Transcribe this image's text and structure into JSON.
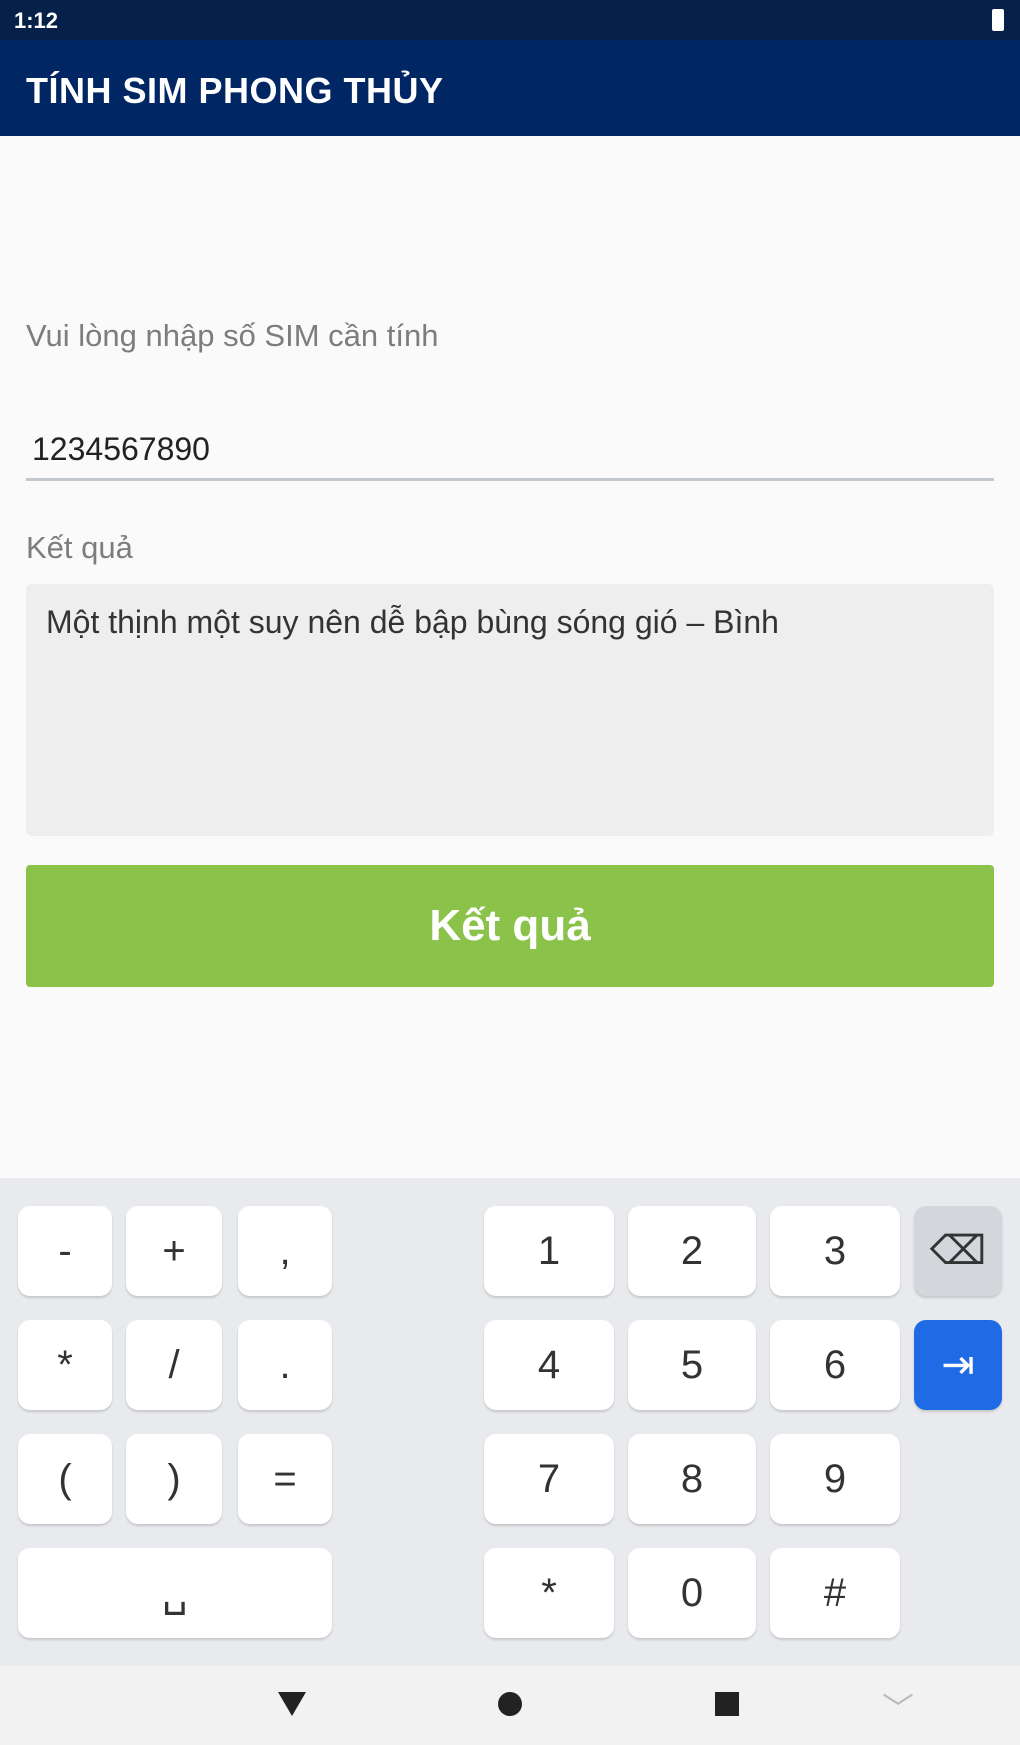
{
  "status_bar": {
    "time": "1:12"
  },
  "app_bar": {
    "title": "TÍNH SIM PHONG THỦY"
  },
  "form": {
    "input_label": "Vui lòng nhập số SIM cần tính",
    "input_value": "1234567890",
    "result_label": "Kết quả",
    "result_text": "Một thịnh một suy nên dễ bập bùng sóng gió – Bình",
    "button_label": "Kết quả"
  },
  "keyboard": {
    "symbols": [
      "-",
      "+",
      ",",
      "*",
      "/",
      ".",
      "(",
      ")",
      "=",
      "␣"
    ],
    "digits": [
      "1",
      "2",
      "3",
      "4",
      "5",
      "6",
      "7",
      "8",
      "9",
      "*",
      "0",
      "#"
    ],
    "delete_glyph": "⌫",
    "next_glyph": "⇥"
  },
  "nav_bar": {
    "icons": [
      "back-icon",
      "home-icon",
      "recents-icon",
      "keyboard-hide-icon"
    ]
  },
  "colors": {
    "status_bar": "#06204a",
    "app_bar": "#002663",
    "button": "#8bc34a",
    "keyboard_next": "#1f6be6"
  }
}
